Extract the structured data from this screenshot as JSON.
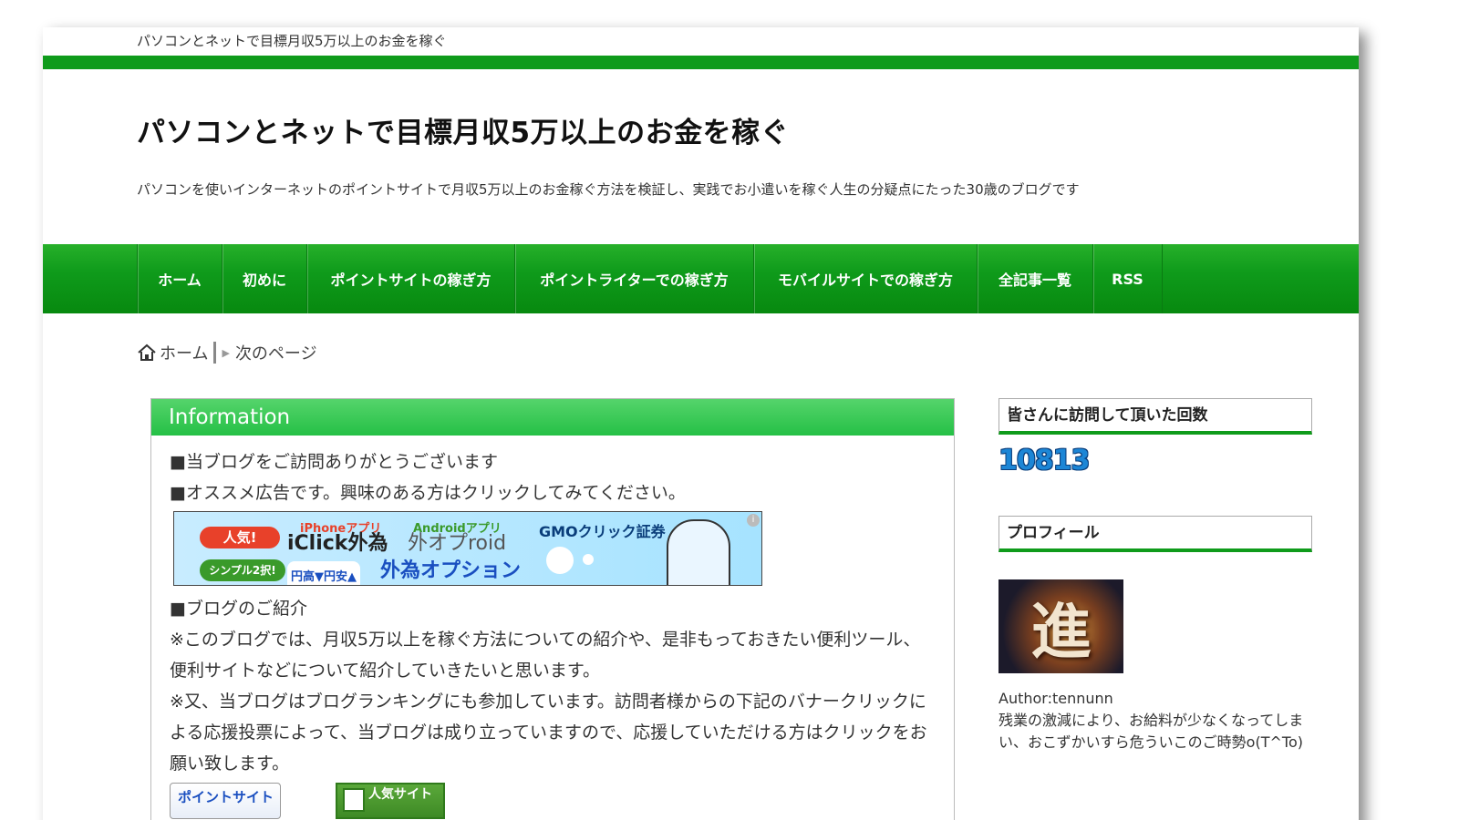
{
  "header": {
    "top_text": "パソコンとネットで目標月収5万以上のお金を稼ぐ",
    "site_title": "パソコンとネットで目標月収5万以上のお金を稼ぐ",
    "site_description": "パソコンを使いインターネットのポイントサイトで月収5万以上のお金稼ぐ方法を検証し、実践でお小遣いを稼ぐ人生の分疑点にたった30歳のブログです"
  },
  "nav": {
    "items": [
      {
        "label": "ホーム"
      },
      {
        "label": "初めに"
      },
      {
        "label": "ポイントサイトの稼ぎ方"
      },
      {
        "label": "ポイントライターでの稼ぎ方"
      },
      {
        "label": "モバイルサイトでの稼ぎ方"
      },
      {
        "label": "全記事一覧"
      },
      {
        "label": "RSS"
      }
    ]
  },
  "breadcrumb": {
    "home": "ホーム",
    "current": "次のページ"
  },
  "info": {
    "heading": "Information",
    "line1": "■当ブログをご訪問ありがとうございます",
    "line2": "■オススメ広告です。興味のある方はクリックしてみてください。",
    "line3": "■ブログのご紹介",
    "line4": "※このブログでは、月収5万以上を稼ぐ方法についての紹介や、是非もっておきたい便利ツール、便利サイトなどについて紹介していきたいと思います。",
    "line5": "※又、当ブログはブログランキングにも参加しています。訪問者様からの下記のバナークリックによる応援投票によって、当ブログは成り立っていますので、応援していただける方はクリックをお願い致します。"
  },
  "ad": {
    "badge": "人気!",
    "iphone": "iPhoneアプリ",
    "android": "Androidアプリ",
    "brand_left": "iClick外為",
    "brand_right": "外オプroid",
    "gmo": "GMOクリック証券",
    "pill_bottom": "シンプル2択!",
    "yen": "円高▼円安▲",
    "option": "外為オプション"
  },
  "banners": {
    "point_site": "ポイントサイト",
    "popular_site": "人気サイト"
  },
  "sidebar": {
    "visits_heading": "皆さんに訪問して頂いた回数",
    "counter": "10813",
    "profile_heading": "プロフィール",
    "avatar_glyph": "進",
    "author": "Author:tennunn",
    "bio": "残業の激減により、お給料が少なくなってしまい、おこずかいすら危ういこのご時勢o(T^To)"
  },
  "colors": {
    "brand_green": "#0f9b1b",
    "info_green": "#25c046",
    "counter_blue": "#1c86d6"
  }
}
